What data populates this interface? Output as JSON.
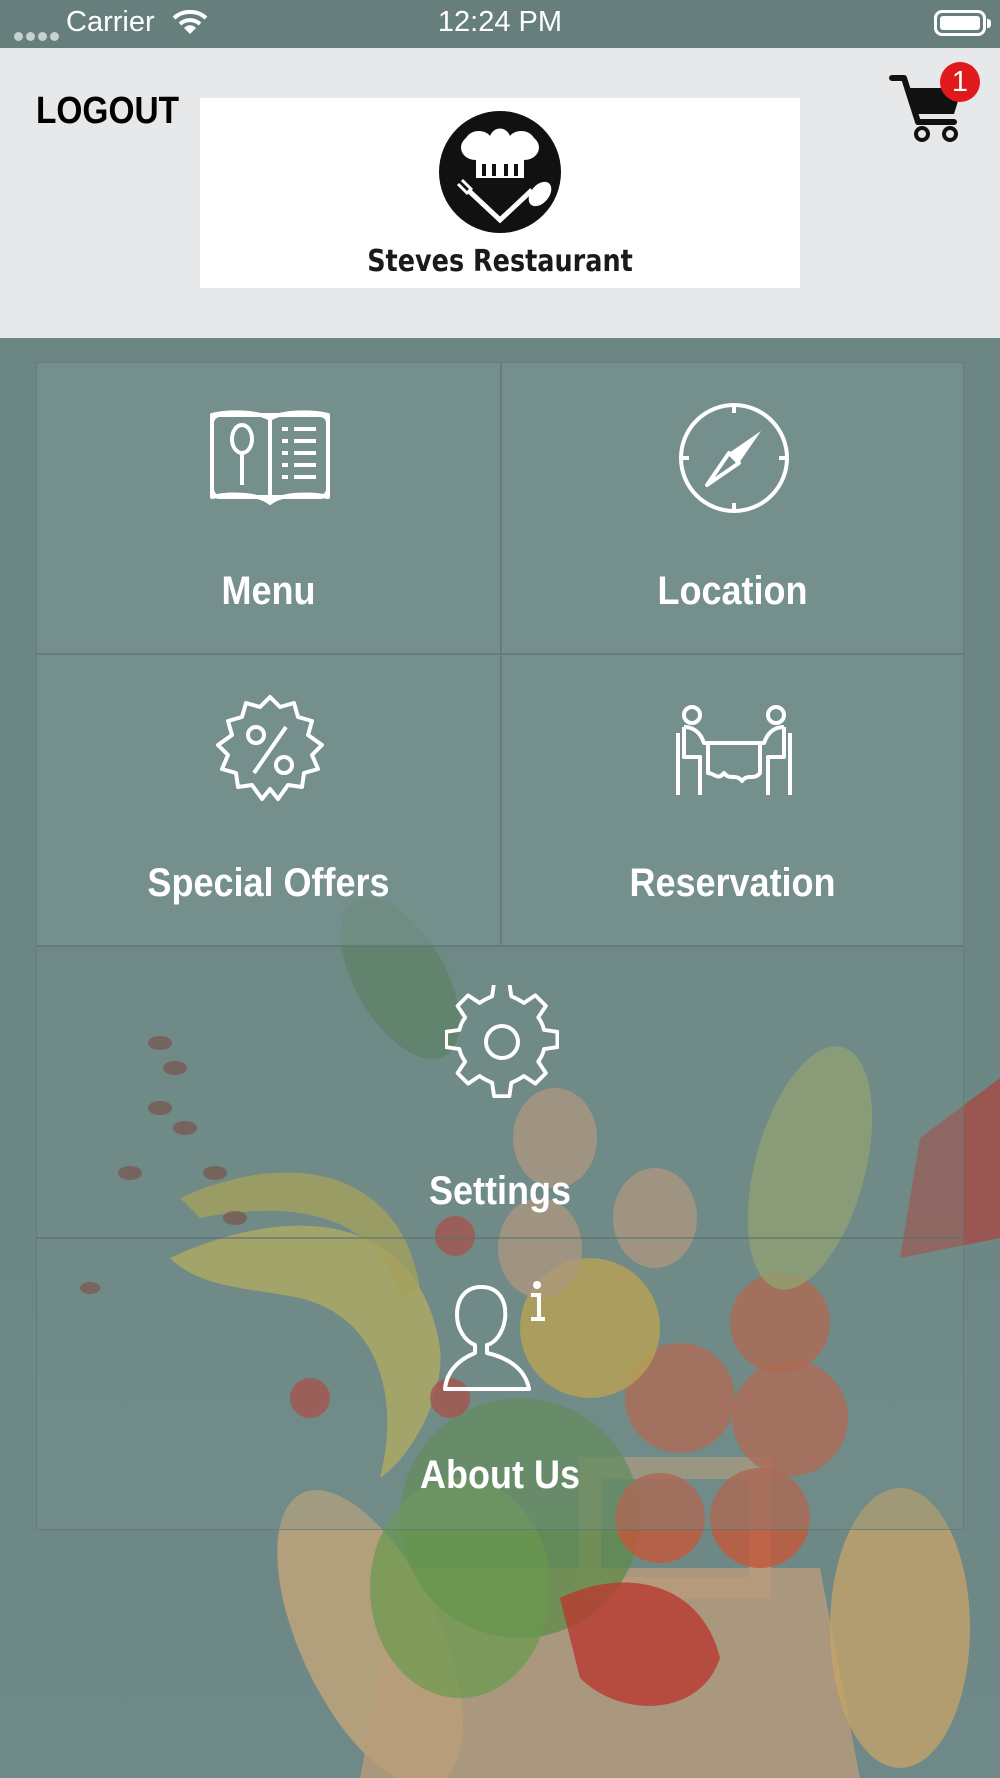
{
  "status_bar": {
    "carrier": "Carrier",
    "time": "12:24 PM"
  },
  "header": {
    "logout_label": "LOGOUT",
    "logo_text": "Steves Restaurant",
    "cart_count": "1"
  },
  "tiles": [
    {
      "label": "Menu",
      "icon": "menu-book-icon"
    },
    {
      "label": "Location",
      "icon": "compass-icon"
    },
    {
      "label": "Special Offers",
      "icon": "percent-badge-icon"
    },
    {
      "label": "Reservation",
      "icon": "dining-table-icon"
    },
    {
      "label": "Settings",
      "icon": "gear-icon"
    },
    {
      "label": "About Us",
      "icon": "person-info-icon"
    }
  ],
  "colors": {
    "header_bg": "#e6e8e9",
    "tile_bg": "#78918f",
    "badge": "#e0191c"
  }
}
